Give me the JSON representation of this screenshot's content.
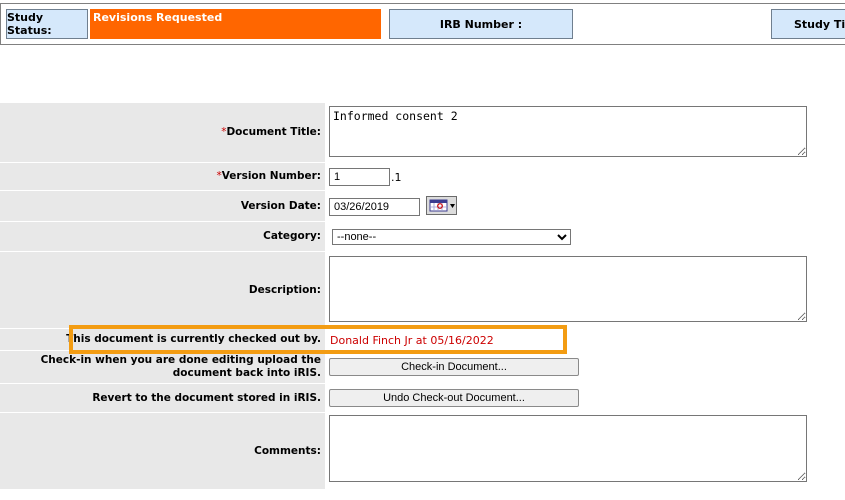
{
  "status_bar": {
    "study_status_label": "Study Status:",
    "study_status_value": "Revisions Requested",
    "irb_number_label": "IRB Number :",
    "study_title_label": "Study Title"
  },
  "form": {
    "required_marker": "*",
    "document_title": {
      "label": "Document Title:",
      "value": "Informed consent 2"
    },
    "version_number": {
      "label": "Version Number:",
      "value": "1",
      "suffix": ".1"
    },
    "version_date": {
      "label": "Version Date:",
      "value": "03/26/2019"
    },
    "category": {
      "label": "Category:",
      "selected": "--none--"
    },
    "description": {
      "label": "Description:",
      "value": ""
    },
    "checkout_notice": {
      "label": "This document is currently checked out by.",
      "value": "Donald Finch Jr at 05/16/2022"
    },
    "checkin": {
      "label": "Check-in when you are done editing upload the document back into iRIS.",
      "button": "Check-in Document..."
    },
    "revert": {
      "label": "Revert to the document stored in iRIS.",
      "button": "Undo Check-out Document..."
    },
    "comments": {
      "label": "Comments:",
      "value": ""
    }
  },
  "colors": {
    "status_orange": "#ff6600",
    "header_blue": "#d5e8fb",
    "highlight": "#f39c12",
    "checkout_text": "#cc0000"
  }
}
